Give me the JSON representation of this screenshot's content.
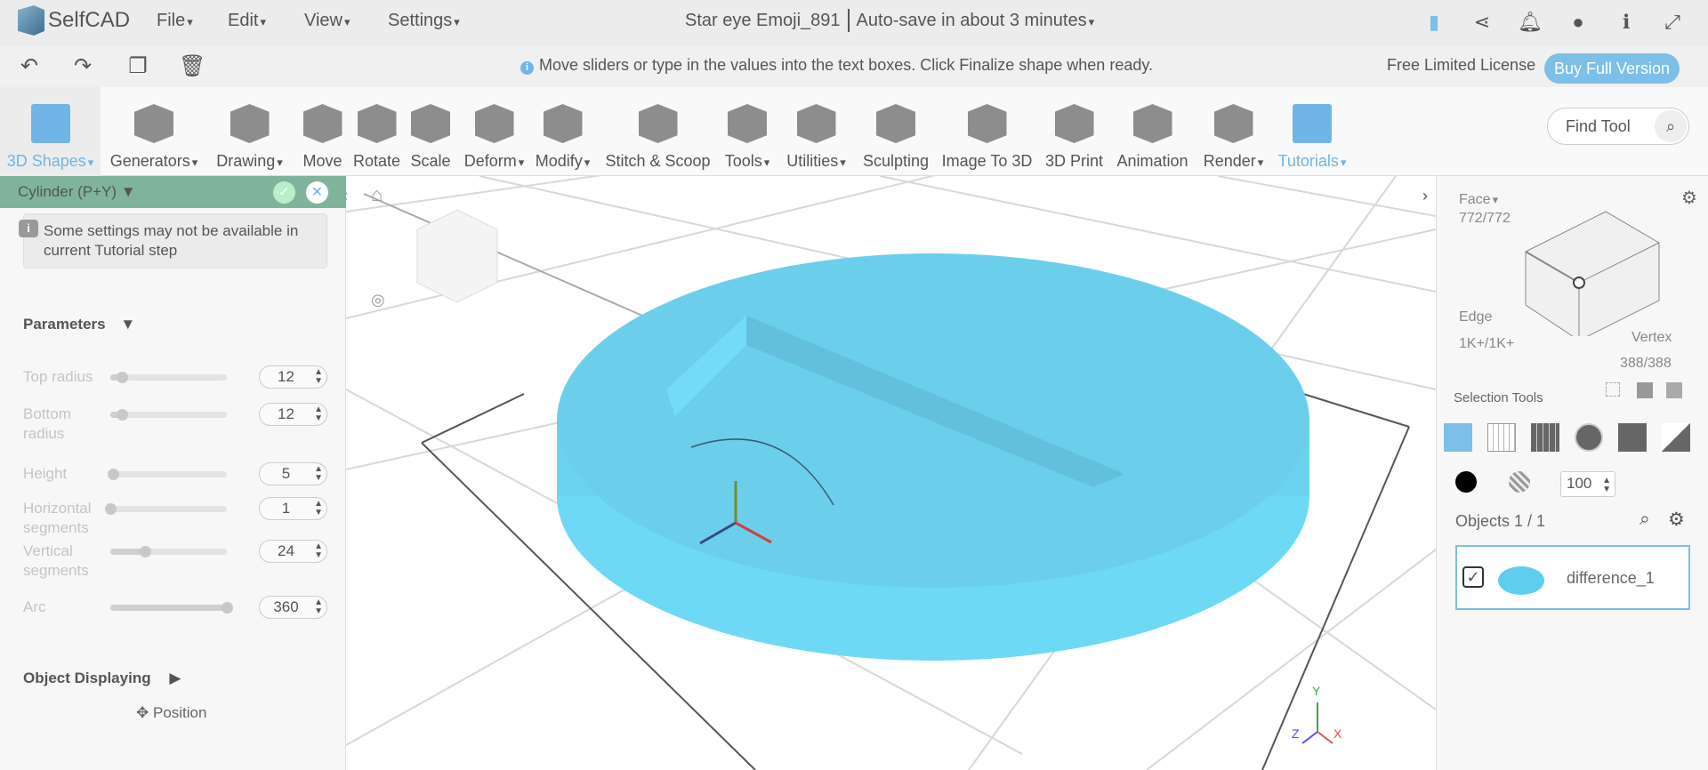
{
  "app": {
    "name": "SelfCAD",
    "menus": [
      "File",
      "Edit",
      "View",
      "Settings"
    ],
    "doc_title": "Star eye Emoji_891",
    "autosave": "Auto-save in about 3 minutes"
  },
  "top_icons": [
    "save-icon",
    "share-icon",
    "bell-icon",
    "user-icon",
    "info-icon",
    "fullscreen-icon"
  ],
  "edit_icons": [
    "undo-icon",
    "redo-icon",
    "copy-icon",
    "delete-icon"
  ],
  "hint": "Move sliders or type in the values into the text boxes. Click Finalize shape when ready.",
  "license": "Free Limited License",
  "buy": "Buy Full Version",
  "tools": [
    {
      "label": "3D Shapes",
      "dd": true
    },
    {
      "label": "Generators",
      "dd": true
    },
    {
      "label": "Drawing",
      "dd": true
    },
    {
      "label": "Move"
    },
    {
      "label": "Rotate"
    },
    {
      "label": "Scale"
    },
    {
      "label": "Deform",
      "dd": true
    },
    {
      "label": "Modify",
      "dd": true
    },
    {
      "label": "Stitch & Scoop"
    },
    {
      "label": "Tools",
      "dd": true
    },
    {
      "label": "Utilities",
      "dd": true
    },
    {
      "label": "Sculpting"
    },
    {
      "label": "Image To 3D"
    },
    {
      "label": "3D Print"
    },
    {
      "label": "Animation"
    },
    {
      "label": "Render",
      "dd": true
    },
    {
      "label": "Tutorials",
      "dd": true
    }
  ],
  "find_tool": "Find Tool",
  "panel": {
    "title": "Cylinder (P+Y)",
    "note": "Some settings may not be available in current Tutorial step",
    "parameters": "Parameters",
    "params": [
      {
        "label": "Top radius",
        "value": "12",
        "fraction": 0.1
      },
      {
        "label": "Bottom radius",
        "value": "12",
        "fraction": 0.1
      },
      {
        "label": "Height",
        "value": "5",
        "fraction": 0.02
      },
      {
        "label": "Horizontal segments",
        "value": "1",
        "fraction": 0.0
      },
      {
        "label": "Vertical segments",
        "value": "24",
        "fraction": 0.3
      },
      {
        "label": "Arc",
        "value": "360",
        "fraction": 1.0
      }
    ],
    "object_displaying": "Object Displaying",
    "position": "Position"
  },
  "right": {
    "face": "Face",
    "face_count": "772/772",
    "edge": "Edge",
    "edge_count": "1K+/1K+",
    "vertex": "Vertex",
    "vertex_count": "388/388",
    "selection_tools": "Selection Tools",
    "opacity": "100",
    "objects": "Objects 1 / 1",
    "object_name": "difference_1"
  },
  "axes": {
    "x": "X",
    "y": "Y",
    "z": "Z"
  },
  "colors": {
    "accent": "#7cbfe8",
    "object": "#6bcfeb",
    "panel_header": "#7fb39b"
  }
}
